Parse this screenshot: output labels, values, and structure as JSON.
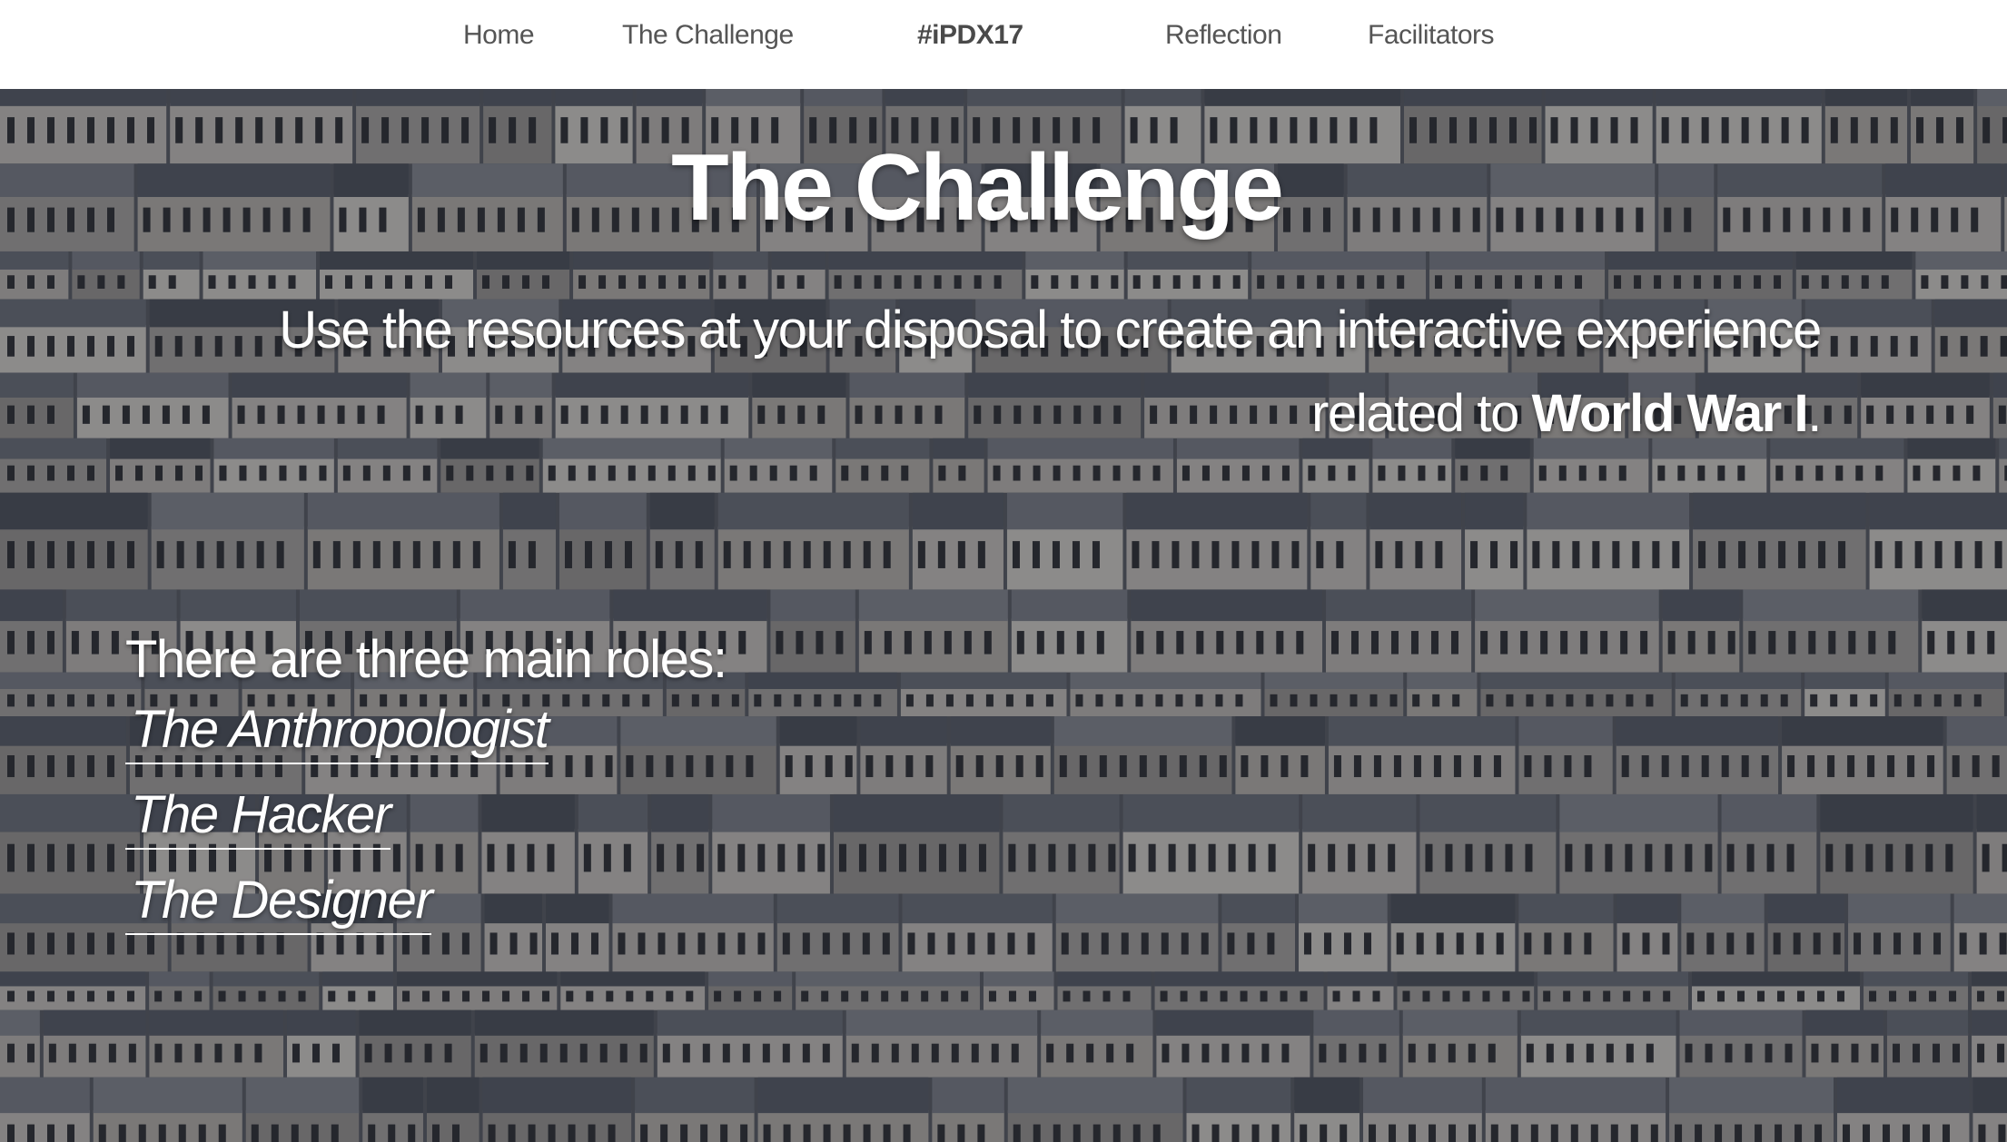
{
  "nav": {
    "home": "Home",
    "challenge": "The Challenge",
    "brand": "#iPDX17",
    "reflection": "Reflection",
    "facilitators": "Facilitators"
  },
  "hero": {
    "title": "The Challenge",
    "text_before": "Use the resources at your disposal to create an interactive experience related to ",
    "text_strong": "World War I",
    "text_after": "."
  },
  "roles": {
    "intro": "There are three main roles:",
    "items": [
      "The Anthropologist",
      "The Hacker",
      "The Designer"
    ]
  },
  "colors": {
    "nav_background": "#ffffff",
    "nav_text": "#555555",
    "hero_text": "#ffffff",
    "hero_tint": "#3b3f46"
  }
}
